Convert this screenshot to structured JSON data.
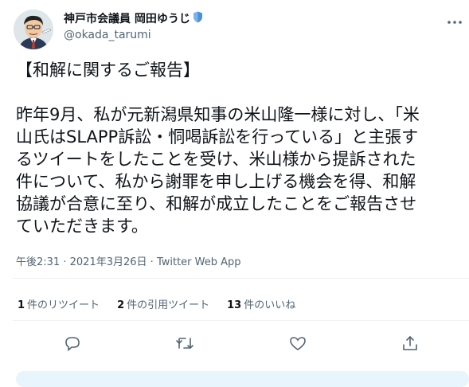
{
  "author": {
    "name": "神戸市会議員 岡田ゆうじ",
    "handle": "@okada_tarumi",
    "avatar_icon": "caricature-avatar",
    "badge_icon": "shield-icon",
    "badge_color": "#4a90d9"
  },
  "more_icon": "more-options-icon",
  "tweet": {
    "heading": "【和解に関するご報告】",
    "lines": [
      "昨年9月、私が元新潟県知事の米山隆一様に対し、「米",
      "山氏はSLAPP訴訟・恫喝訴訟を行っている」と主張す",
      "るツイートをしたことを受け、米山様から提訴された",
      "件について、私から謝罪を申し上げる機会を得、和解",
      "協議が合意に至り、和解が成立したことをご報告させ",
      "ていただきます。"
    ]
  },
  "meta": {
    "time": "午後2:31",
    "separator1": "·",
    "date": "2021年3月26日",
    "separator2": "·",
    "source": "Twitter Web App"
  },
  "stats": [
    {
      "count": "1",
      "label": "件のリツイート"
    },
    {
      "count": "2",
      "label": "件の引用ツイート"
    },
    {
      "count": "13",
      "label": "件のいいね"
    }
  ],
  "actions": [
    "reply-icon",
    "retweet-icon",
    "like-icon",
    "share-icon"
  ],
  "colors": {
    "text": "#0f1419",
    "secondary": "#536471",
    "divider": "#eff3f4",
    "bottom_bar": "#e8f5fd"
  }
}
